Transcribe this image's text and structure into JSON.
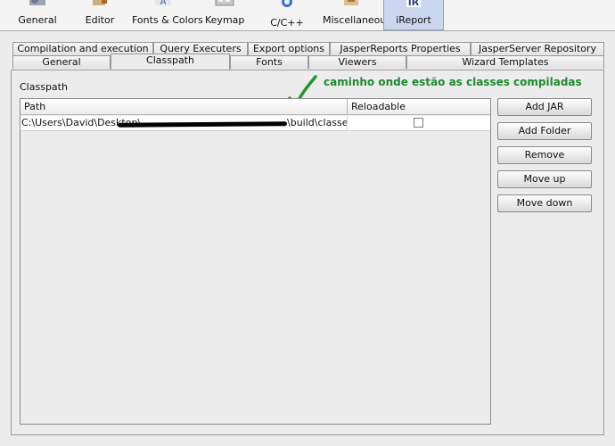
{
  "toolbar": {
    "categories": [
      {
        "label": "General",
        "icon": "general-icon"
      },
      {
        "label": "Editor",
        "icon": "editor-icon"
      },
      {
        "label": "Fonts & Colors",
        "icon": "fonts-colors-icon"
      },
      {
        "label": "Keymap",
        "icon": "keymap-icon"
      },
      {
        "label": "C/C++",
        "icon": "cpp-icon"
      },
      {
        "label": "Miscellaneous",
        "icon": "miscellaneous-icon"
      },
      {
        "label": "iReport",
        "icon": "ireport-icon",
        "selected": true
      }
    ]
  },
  "tabs": {
    "row_back": [
      "Compilation and execution",
      "Query Executers",
      "Export options",
      "JasperReports Properties",
      "JasperServer Repository"
    ],
    "row_front": [
      "General",
      "Classpath",
      "Fonts",
      "Viewers",
      "Wizard Templates"
    ],
    "selected": "Classpath"
  },
  "classpath": {
    "section_label": "Classpath",
    "annotation": "caminho onde estão as classes compiladas",
    "annotation_color": "#1f8a2e",
    "columns": [
      "Path",
      "Reloadable"
    ],
    "rows": [
      {
        "path_start": "C:\\Users\\David\\Desktop\\",
        "path_end": "\\build\\classes",
        "reloadable": false
      }
    ],
    "buttons": [
      "Add JAR",
      "Add Folder",
      "Remove",
      "Move up",
      "Move down"
    ]
  }
}
